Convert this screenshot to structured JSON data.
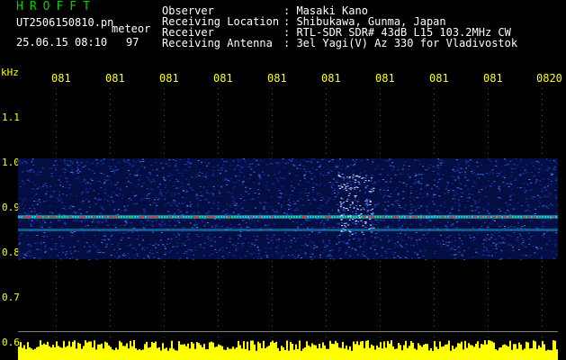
{
  "app": {
    "title": "HROFFT"
  },
  "file": {
    "name": "UT2506150810.pn",
    "type": "meteor"
  },
  "timestamp": {
    "date_time": "25.06.15 08:10",
    "count": "97"
  },
  "info": {
    "labels": [
      "Observer",
      "Receiving Location",
      "Receiver",
      "Receiving Antenna"
    ],
    "values": [
      ": Masaki Kano",
      ": Shibukawa, Gunma, Japan",
      ": RTL-SDR SDR# 43dB L15 103.2MHz CW",
      ": 3el Yagi(V) Az 330 for Vladivostok"
    ]
  },
  "axis": {
    "unit": "kHz",
    "x_ticks": [
      "081",
      "081",
      "081",
      "081",
      "081",
      "081",
      "081",
      "081",
      "081",
      "0820"
    ],
    "y_ticks": [
      "1.1",
      "1.0",
      "0.9",
      "0.8",
      "0.7",
      "0.6"
    ]
  },
  "colors": {
    "title": "#00d000",
    "axis": "#ffff00",
    "text": "#ffffff",
    "signal_red": "#ff3030",
    "background_noise": "#1030a0",
    "level_bar": "#ffff00",
    "level_bar_base": "#00e0ff"
  }
}
